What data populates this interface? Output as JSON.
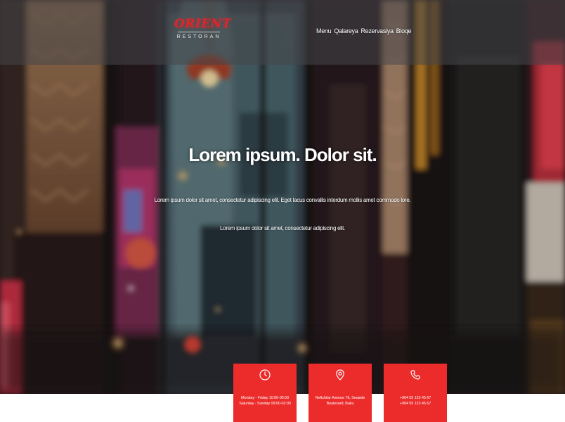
{
  "header": {
    "logo_main": "ORIENT",
    "logo_sub": "RESTORAN",
    "nav": [
      "Menu",
      "Qalareya",
      "Rezervasiya",
      "Bloqe"
    ]
  },
  "hero": {
    "title": "Lorem ipsum. Dolor sit.",
    "paragraph1": "Lorem ipsum dolor sit amet, consectetur adipiscing elit. Eget lacus convallis interdum mollis amet commodo lore.",
    "paragraph2": "Lorem ipsum dolor sit amet, consectetur adipiscing elit."
  },
  "cards": [
    {
      "icon": "clock-icon",
      "lines": [
        "Monday - Friday 10:00-00:00",
        "Saturday - Sunday 09:00-02:00"
      ]
    },
    {
      "icon": "location-pin-icon",
      "lines": [
        "Neftchilar Avenue 78, Seaside",
        "Boulevard, Baku"
      ]
    },
    {
      "icon": "phone-icon",
      "lines": [
        "+994 55 123 45 67",
        "+994 55 123 45 67"
      ]
    }
  ],
  "colors": {
    "accent": "#ec2b2b",
    "header_overlay": "rgba(70,70,72,0.55)",
    "text": "#ffffff"
  }
}
